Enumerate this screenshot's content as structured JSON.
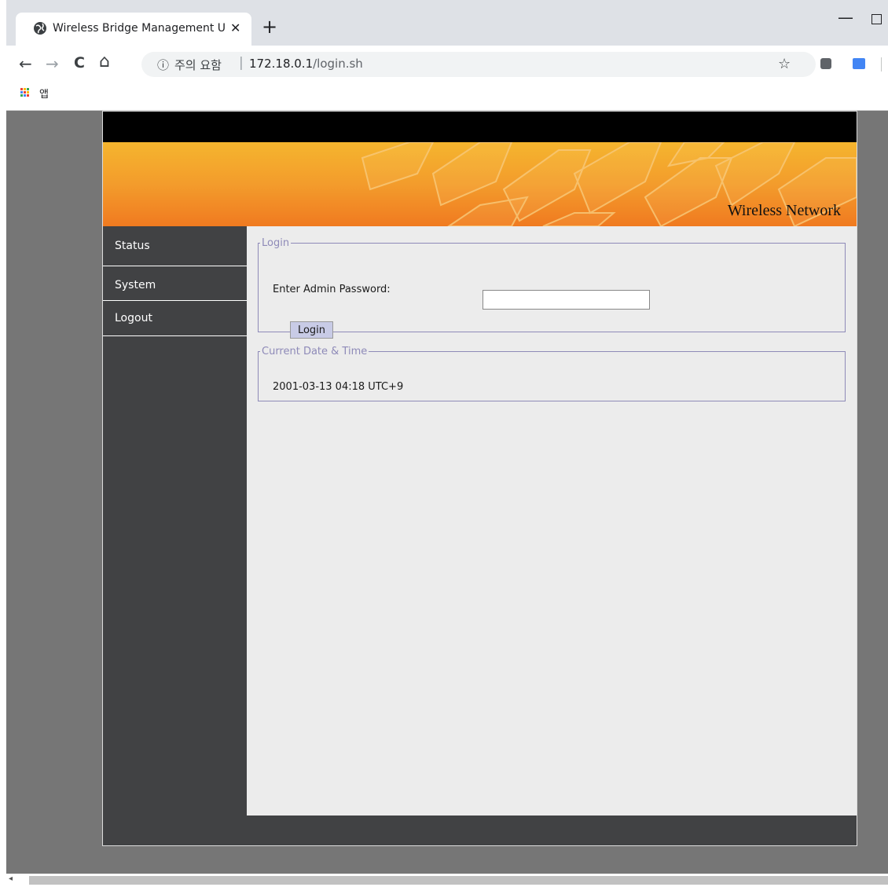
{
  "browser": {
    "tab_title": "Wireless Bridge Management UI",
    "tab_close": "✕",
    "new_tab": "+",
    "minimize": "—",
    "security_icon": "ⓘ",
    "security_warning": "주의 요함",
    "url_separator": "|",
    "url_host": "172.18.0.1",
    "url_path": "/login.sh",
    "back": "←",
    "forward": "→",
    "reload": "C",
    "home": "⌂",
    "star": "☆",
    "bookmark_apps_label": "앱",
    "scroll_left": "◂"
  },
  "page": {
    "banner_title": "Wireless Network",
    "sidebar": {
      "items": [
        {
          "label": "Status"
        },
        {
          "label": "System"
        },
        {
          "label": "Logout"
        }
      ]
    },
    "login": {
      "legend": "Login",
      "prompt": "Enter Admin Password:",
      "password_value": "",
      "button_label": "Login"
    },
    "datetime": {
      "legend": "Current Date & Time",
      "value": "2001-03-13 04:18 UTC+9"
    }
  },
  "colors": {
    "sidebar_bg": "#414244",
    "banner_orange": "#f39c2c",
    "fieldset_border": "#8e8ab8",
    "content_bg": "#ececec"
  }
}
